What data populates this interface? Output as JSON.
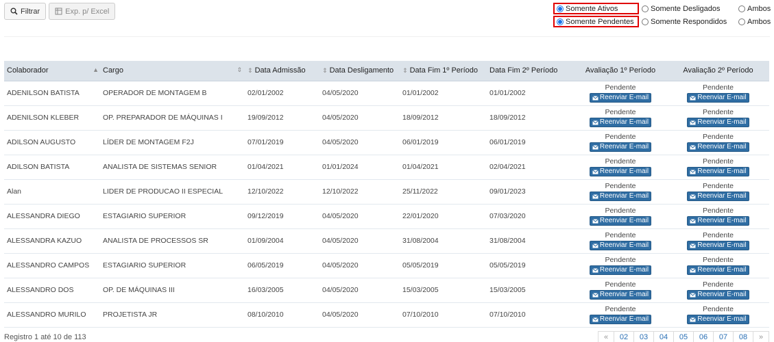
{
  "toolbar": {
    "filter_label": "Filtrar",
    "export_label": "Exp. p/ Excel"
  },
  "filters": {
    "row1": [
      "Somente Ativos",
      "Somente Desligados",
      "Ambos"
    ],
    "row2": [
      "Somente Pendentes",
      "Somente Respondidos",
      "Ambos"
    ],
    "selected_row1": "Somente Ativos",
    "selected_row2": "Somente Pendentes"
  },
  "table": {
    "headers": [
      "Colaborador",
      "Cargo",
      "Data Admissão",
      "Data Desligamento",
      "Data Fim 1º Período",
      "Data Fim 2º Período",
      "Avaliação 1º Período",
      "Avaliação 2º Período"
    ],
    "status_label": "Pendente",
    "resend_label": "Reenviar E-mail",
    "rows": [
      [
        "ADENILSON BATISTA",
        "OPERADOR DE MONTAGEM B",
        "02/01/2002",
        "04/05/2020",
        "01/01/2002",
        "01/01/2002"
      ],
      [
        "ADENILSON KLEBER",
        "OP. PREPARADOR DE MÁQUINAS I",
        "19/09/2012",
        "04/05/2020",
        "18/09/2012",
        "18/09/2012"
      ],
      [
        "ADILSON AUGUSTO",
        "LÍDER DE MONTAGEM F2J",
        "07/01/2019",
        "04/05/2020",
        "06/01/2019",
        "06/01/2019"
      ],
      [
        "ADILSON BATISTA",
        "ANALISTA DE SISTEMAS SENIOR",
        "01/04/2021",
        "01/01/2024",
        "01/04/2021",
        "02/04/2021"
      ],
      [
        "Alan",
        "LIDER DE PRODUCAO II ESPECIAL",
        "12/10/2022",
        "12/10/2022",
        "25/11/2022",
        "09/01/2023"
      ],
      [
        "ALESSANDRA DIEGO",
        "ESTAGIARIO SUPERIOR",
        "09/12/2019",
        "04/05/2020",
        "22/01/2020",
        "07/03/2020"
      ],
      [
        "ALESSANDRA KAZUO",
        "ANALISTA DE PROCESSOS SR",
        "01/09/2004",
        "04/05/2020",
        "31/08/2004",
        "31/08/2004"
      ],
      [
        "ALESSANDRO CAMPOS",
        "ESTAGIARIO SUPERIOR",
        "06/05/2019",
        "04/05/2020",
        "05/05/2019",
        "05/05/2019"
      ],
      [
        "ALESSANDRO DOS",
        "OP. DE MÁQUINAS III",
        "16/03/2005",
        "04/05/2020",
        "15/03/2005",
        "15/03/2005"
      ],
      [
        "ALESSANDRO MURILO",
        "PROJETISTA JR",
        "08/10/2010",
        "04/05/2020",
        "07/10/2010",
        "07/10/2010"
      ]
    ]
  },
  "footer": {
    "records_text": "Registro 1 até 10 de 113"
  },
  "pagination": {
    "prev": "«",
    "pages": [
      "02",
      "03",
      "04",
      "05",
      "06",
      "07",
      "08"
    ],
    "next": "»"
  },
  "colors": {
    "header_bg": "#dce3ea",
    "button_blue": "#2f6da3",
    "highlight_red": "#e00000",
    "link_blue": "#2a6fb5"
  }
}
